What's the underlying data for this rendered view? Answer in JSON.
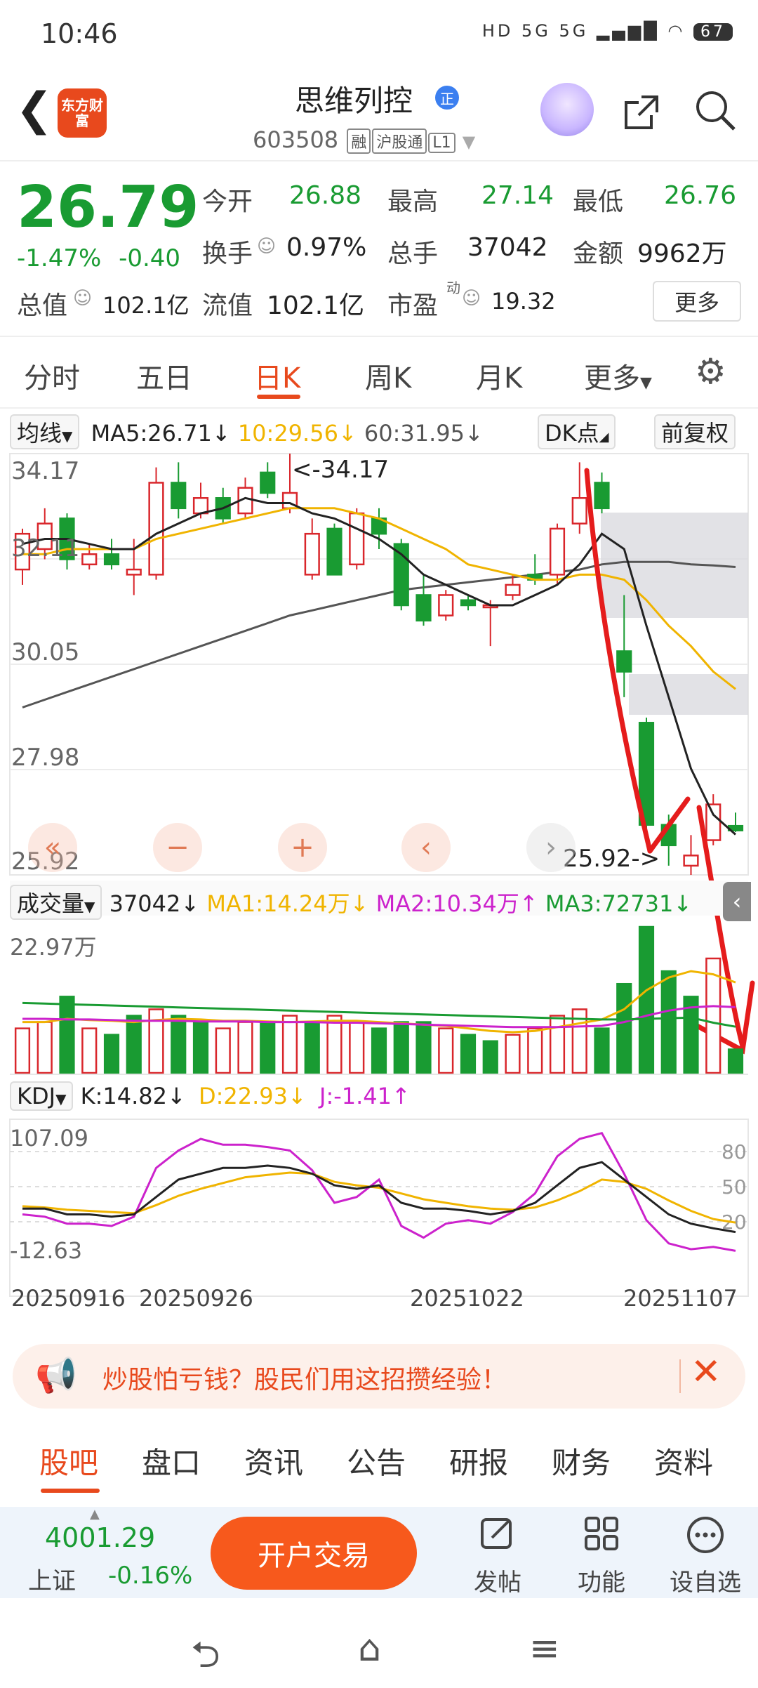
{
  "status_bar": {
    "time": "10:46",
    "icons": "HD 5G 5G",
    "battery": "67"
  },
  "header": {
    "back_glyph": "❮",
    "app_logo": "东方财富",
    "stock_name": "思维列控",
    "badge": "正",
    "stock_code": "603508",
    "tags": [
      "融",
      "沪股通",
      "L1"
    ]
  },
  "quote": {
    "price": "26.79",
    "change_pct": "-1.47%",
    "change": "-0.40",
    "items": [
      {
        "label": "今开",
        "value": "26.88"
      },
      {
        "label": "最高",
        "value": "27.14"
      },
      {
        "label": "最低",
        "value": "26.76"
      },
      {
        "label": "换手",
        "value": "0.97%"
      },
      {
        "label": "总手",
        "value": "37042"
      },
      {
        "label": "金额",
        "value": "9962万"
      },
      {
        "label": "总值",
        "value": "102.1亿"
      },
      {
        "label": "流值",
        "value": "102.1亿"
      },
      {
        "label": "市盈",
        "superscript": "动",
        "value": "19.32"
      }
    ],
    "more_button": "更多"
  },
  "period_tabs": [
    "分时",
    "五日",
    "日K",
    "周K",
    "月K",
    "更多"
  ],
  "active_tab": "日K",
  "ma_row": {
    "selector": "均线",
    "ma5": "MA5:26.71↓",
    "ma10": "10:29.56↓",
    "ma60": "60:31.95↓",
    "dk_button": "DK点",
    "adjust_button": "前复权"
  },
  "price_axis": [
    "34.17",
    "32.11",
    "30.05",
    "27.98",
    "25.92"
  ],
  "annotations": {
    "high": "<-34.17",
    "low": "25.92->"
  },
  "nav_controls": [
    "«",
    "−",
    "+",
    "‹",
    "›"
  ],
  "volume_row": {
    "selector": "成交量",
    "value": "37042↓",
    "ma1": "MA1:14.24万↓",
    "ma2": "MA2:10.34万↑",
    "ma3": "MA3:72731↓",
    "axis_max": "22.97万"
  },
  "kdj_row": {
    "selector": "KDJ",
    "k": "K:14.82↓",
    "d": "D:22.93↓",
    "j": "J:-1.41↑",
    "axis_max": "107.09",
    "axis_min": "-12.63",
    "levels": [
      "80",
      "50",
      "20"
    ]
  },
  "date_axis": [
    "20250916",
    "20250926",
    "20251022",
    "20251107"
  ],
  "banner": {
    "text": "炒股怕亏钱？股民们用这招攒经验！",
    "close": "✕"
  },
  "bottom_tabs": [
    "股吧",
    "盘口",
    "资讯",
    "公告",
    "研报",
    "财务",
    "资料"
  ],
  "bottom_bar": {
    "index_value": "4001.29",
    "index_name": "上证",
    "index_change": "-0.16%",
    "trade_button": "开户交易",
    "actions": [
      {
        "icon": "edit-icon",
        "label": "发帖"
      },
      {
        "icon": "grid-icon",
        "label": "功能"
      },
      {
        "icon": "dots-icon",
        "label": "设自选"
      }
    ]
  },
  "colors": {
    "up": "#d9262b",
    "down": "#199b32",
    "accent": "#e8491d",
    "ma5": "#222222",
    "ma10": "#f0b400",
    "ma60": "#555555",
    "kdj_j": "#cc22cc"
  },
  "chart_data": {
    "type": "candlestick",
    "title": "",
    "ylim": [
      25.92,
      34.17
    ],
    "candles": [
      {
        "o": 31.9,
        "h": 32.7,
        "l": 31.6,
        "c": 32.6,
        "dir": "up"
      },
      {
        "o": 32.3,
        "h": 33.1,
        "l": 32.1,
        "c": 32.8,
        "dir": "up"
      },
      {
        "o": 32.9,
        "h": 33.0,
        "l": 31.9,
        "c": 32.1,
        "dir": "down"
      },
      {
        "o": 32.0,
        "h": 32.4,
        "l": 31.9,
        "c": 32.2,
        "dir": "up"
      },
      {
        "o": 32.2,
        "h": 32.5,
        "l": 31.9,
        "c": 32.0,
        "dir": "down"
      },
      {
        "o": 31.8,
        "h": 32.5,
        "l": 31.4,
        "c": 31.9,
        "dir": "up"
      },
      {
        "o": 31.8,
        "h": 33.9,
        "l": 31.7,
        "c": 33.6,
        "dir": "up"
      },
      {
        "o": 33.6,
        "h": 34.0,
        "l": 32.9,
        "c": 33.1,
        "dir": "down"
      },
      {
        "o": 33.0,
        "h": 33.6,
        "l": 32.9,
        "c": 33.3,
        "dir": "up"
      },
      {
        "o": 33.3,
        "h": 33.5,
        "l": 32.8,
        "c": 32.9,
        "dir": "down"
      },
      {
        "o": 33.0,
        "h": 33.7,
        "l": 32.9,
        "c": 33.5,
        "dir": "up"
      },
      {
        "o": 33.8,
        "h": 34.0,
        "l": 33.3,
        "c": 33.4,
        "dir": "down"
      },
      {
        "o": 33.1,
        "h": 34.17,
        "l": 33.0,
        "c": 33.4,
        "dir": "up"
      },
      {
        "o": 31.8,
        "h": 32.9,
        "l": 31.7,
        "c": 32.6,
        "dir": "up"
      },
      {
        "o": 32.7,
        "h": 32.8,
        "l": 31.8,
        "c": 31.8,
        "dir": "down"
      },
      {
        "o": 32.0,
        "h": 33.1,
        "l": 31.9,
        "c": 33.0,
        "dir": "up"
      },
      {
        "o": 32.9,
        "h": 33.1,
        "l": 32.3,
        "c": 32.6,
        "dir": "down"
      },
      {
        "o": 32.4,
        "h": 32.5,
        "l": 31.1,
        "c": 31.2,
        "dir": "down"
      },
      {
        "o": 31.4,
        "h": 31.8,
        "l": 30.8,
        "c": 30.9,
        "dir": "down"
      },
      {
        "o": 31.0,
        "h": 31.5,
        "l": 30.9,
        "c": 31.4,
        "dir": "up"
      },
      {
        "o": 31.3,
        "h": 31.4,
        "l": 31.1,
        "c": 31.2,
        "dir": "down"
      },
      {
        "o": 31.2,
        "h": 31.3,
        "l": 30.4,
        "c": 31.2,
        "dir": "up"
      },
      {
        "o": 31.4,
        "h": 31.8,
        "l": 31.3,
        "c": 31.6,
        "dir": "up"
      },
      {
        "o": 31.7,
        "h": 32.2,
        "l": 31.6,
        "c": 31.8,
        "dir": "down"
      },
      {
        "o": 31.8,
        "h": 32.8,
        "l": 31.6,
        "c": 32.7,
        "dir": "up"
      },
      {
        "o": 32.8,
        "h": 34.0,
        "l": 32.6,
        "c": 33.3,
        "dir": "up"
      },
      {
        "o": 33.6,
        "h": 33.8,
        "l": 33.0,
        "c": 33.1,
        "dir": "down"
      },
      {
        "o": 30.3,
        "h": 31.4,
        "l": 29.4,
        "c": 29.9,
        "dir": "down"
      },
      {
        "o": 28.9,
        "h": 29.0,
        "l": 26.6,
        "c": 26.9,
        "dir": "down"
      },
      {
        "o": 26.9,
        "h": 27.1,
        "l": 26.1,
        "c": 26.5,
        "dir": "down"
      },
      {
        "o": 26.3,
        "h": 26.7,
        "l": 25.92,
        "c": 26.1,
        "dir": "up"
      },
      {
        "o": 26.6,
        "h": 27.5,
        "l": 26.5,
        "c": 27.3,
        "dir": "up"
      },
      {
        "o": 26.88,
        "h": 27.14,
        "l": 26.76,
        "c": 26.79,
        "dir": "down"
      }
    ],
    "ma5": [
      32.4,
      32.5,
      32.5,
      32.4,
      32.3,
      32.3,
      32.6,
      32.8,
      33.0,
      33.1,
      33.3,
      33.2,
      33.2,
      33.0,
      32.9,
      32.7,
      32.5,
      32.2,
      31.8,
      31.6,
      31.4,
      31.2,
      31.2,
      31.4,
      31.6,
      32.0,
      32.6,
      32.3,
      30.8,
      29.4,
      28.0,
      27.1,
      26.71
    ],
    "ma10": [
      32.2,
      32.2,
      32.3,
      32.3,
      32.3,
      32.3,
      32.5,
      32.6,
      32.7,
      32.8,
      32.9,
      33.0,
      33.1,
      33.1,
      33.1,
      33.0,
      32.9,
      32.7,
      32.5,
      32.3,
      32.0,
      31.9,
      31.8,
      31.7,
      31.7,
      31.8,
      31.8,
      31.7,
      31.3,
      30.8,
      30.4,
      29.9,
      29.56
    ],
    "ma60": [
      29.2,
      29.35,
      29.5,
      29.65,
      29.8,
      29.95,
      30.1,
      30.25,
      30.4,
      30.55,
      30.7,
      30.85,
      31.0,
      31.1,
      31.2,
      31.3,
      31.4,
      31.5,
      31.55,
      31.6,
      31.65,
      31.7,
      31.75,
      31.8,
      31.85,
      31.9,
      32.0,
      32.05,
      32.05,
      32.05,
      32.0,
      31.98,
      31.95
    ],
    "volume": [
      7,
      8,
      12,
      7,
      6,
      9,
      10,
      9,
      8,
      7,
      8,
      8,
      9,
      8,
      9,
      8,
      7,
      8,
      8,
      7,
      6,
      5,
      6,
      7,
      9,
      10,
      7,
      14,
      22.97,
      16,
      12,
      18,
      3.7
    ],
    "volume_dir": [
      "up",
      "up",
      "down",
      "up",
      "down",
      "down",
      "up",
      "down",
      "down",
      "up",
      "up",
      "down",
      "up",
      "down",
      "up",
      "up",
      "down",
      "down",
      "down",
      "up",
      "down",
      "down",
      "up",
      "up",
      "up",
      "up",
      "down",
      "down",
      "down",
      "down",
      "down",
      "up",
      "down"
    ],
    "vol_ma1": [
      8,
      8,
      8.5,
      8.3,
      8.2,
      8.0,
      8.3,
      8.5,
      8.4,
      8.2,
      8.2,
      8.1,
      8.0,
      8.1,
      8.2,
      8.2,
      8.0,
      7.8,
      7.6,
      7.4,
      7.0,
      6.6,
      6.4,
      6.6,
      7.2,
      7.8,
      8.4,
      10.0,
      13.0,
      15.0,
      16.0,
      15.5,
      14.24
    ],
    "vol_ma2": [
      8.5,
      8.5,
      8.4,
      8.4,
      8.3,
      8.2,
      8.2,
      8.2,
      8.1,
      8.1,
      8.1,
      8.0,
      8.0,
      8.0,
      7.9,
      7.9,
      7.8,
      7.7,
      7.6,
      7.5,
      7.4,
      7.3,
      7.2,
      7.2,
      7.2,
      7.3,
      7.4,
      8.0,
      9.0,
      9.8,
      10.3,
      10.5,
      10.34
    ],
    "vol_ma3": [
      11,
      10.9,
      10.8,
      10.7,
      10.6,
      10.5,
      10.4,
      10.3,
      10.2,
      10.1,
      10.0,
      9.9,
      9.8,
      9.7,
      9.6,
      9.5,
      9.4,
      9.3,
      9.2,
      9.1,
      9.0,
      8.9,
      8.8,
      8.7,
      8.6,
      8.5,
      8.4,
      8.4,
      8.5,
      8.6,
      8.7,
      7.9,
      7.27
    ],
    "kdj_ylim": [
      -12.63,
      107.09
    ],
    "kdj_k": [
      35,
      35,
      30,
      30,
      28,
      30,
      45,
      60,
      65,
      70,
      70,
      72,
      70,
      65,
      55,
      52,
      55,
      40,
      35,
      35,
      33,
      30,
      33,
      40,
      55,
      70,
      75,
      60,
      45,
      30,
      22,
      18,
      14.82
    ],
    "kdj_d": [
      37,
      36,
      34,
      33,
      32,
      31,
      38,
      46,
      52,
      57,
      62,
      64,
      66,
      65,
      58,
      55,
      53,
      48,
      43,
      40,
      37,
      35,
      34,
      36,
      42,
      50,
      60,
      58,
      52,
      42,
      33,
      26,
      22.93
    ],
    "kdj_j": [
      30,
      28,
      22,
      22,
      20,
      28,
      70,
      85,
      95,
      90,
      90,
      88,
      85,
      68,
      40,
      45,
      60,
      20,
      10,
      22,
      25,
      22,
      32,
      48,
      80,
      95,
      100,
      65,
      25,
      5,
      0,
      2,
      -1.41
    ]
  }
}
